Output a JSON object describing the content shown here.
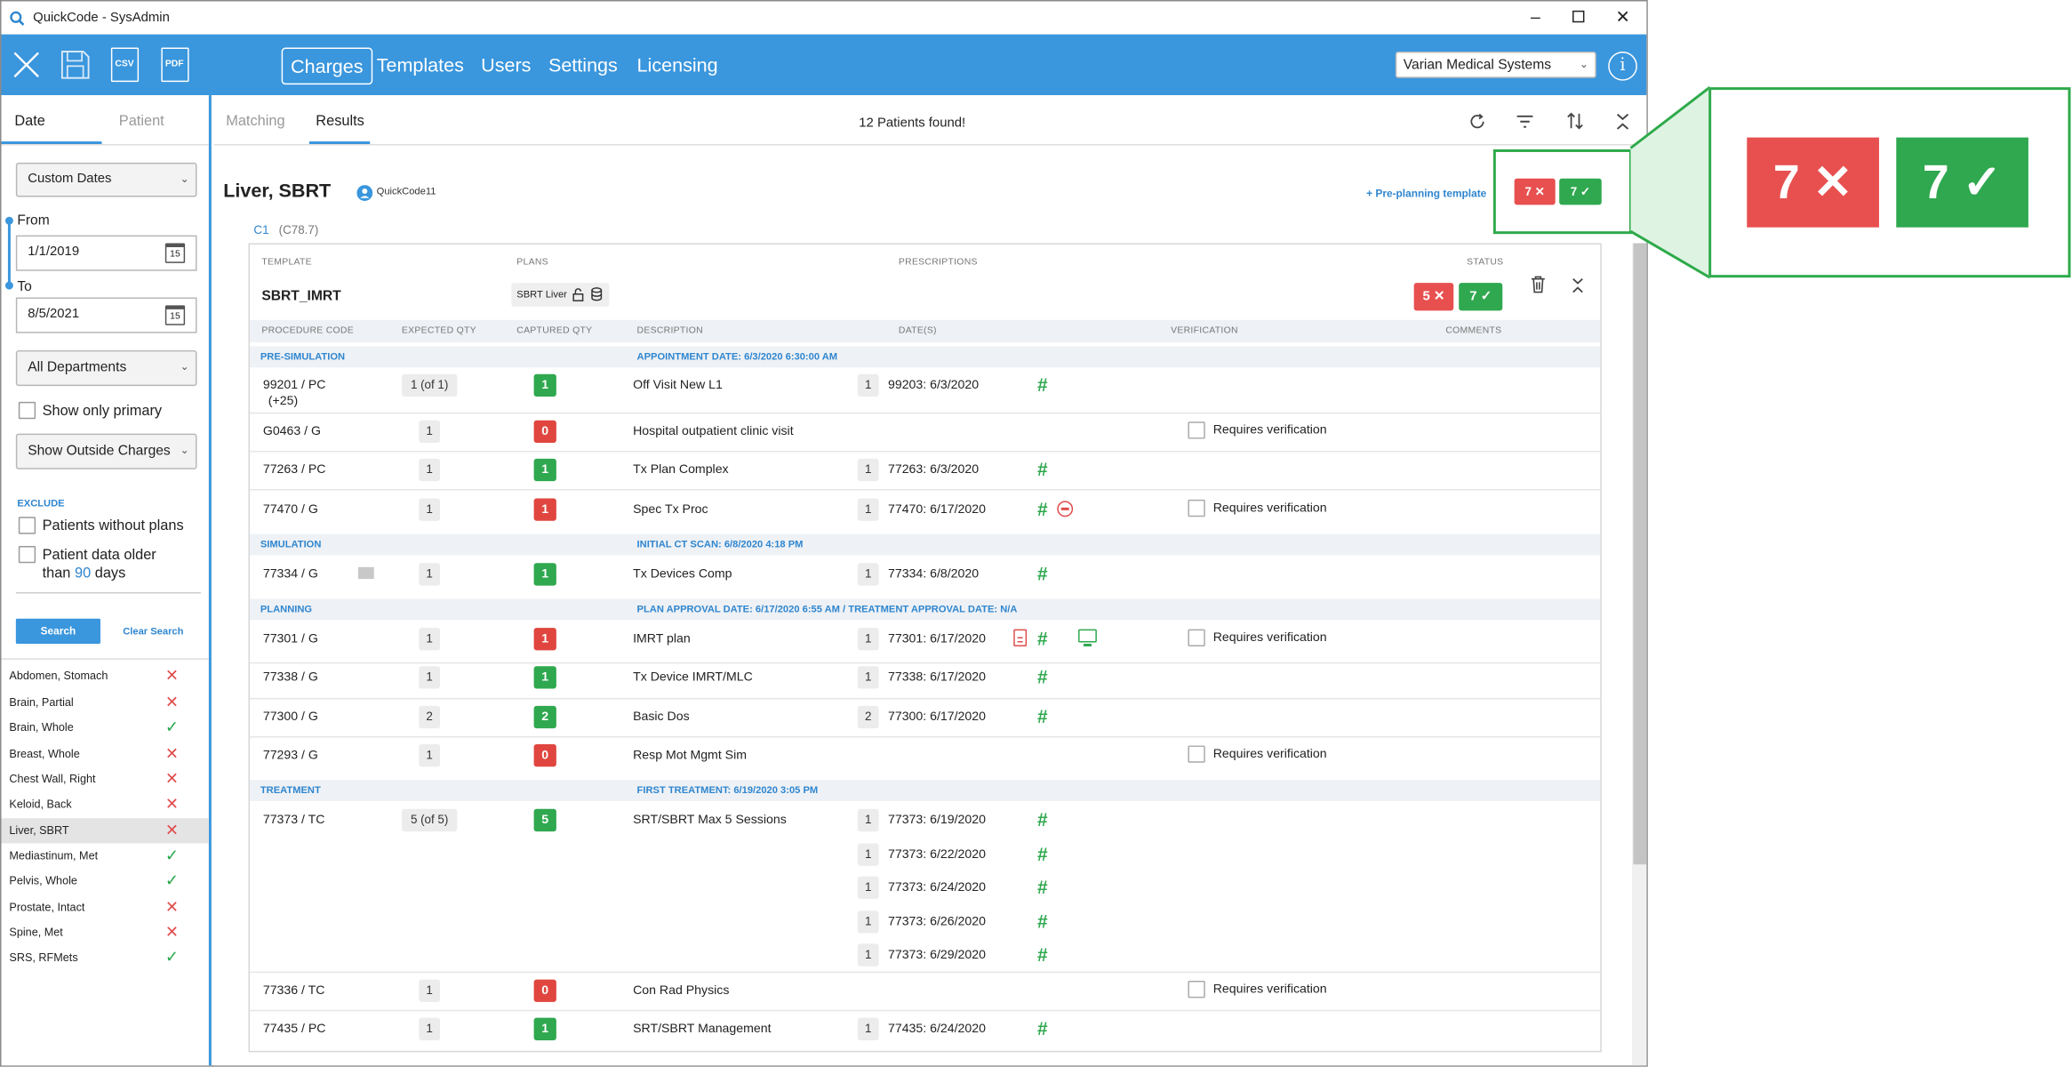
{
  "window": {
    "title": "QuickCode - SysAdmin"
  },
  "toolbar": {
    "nav": [
      "Charges",
      "Templates",
      "Users",
      "Settings",
      "Licensing"
    ],
    "vendor": "Varian Medical Systems",
    "csv_label": "CSV",
    "pdf_label": "PDF",
    "info_label": "i"
  },
  "sidebar": {
    "tabs": [
      "Date",
      "Patient"
    ],
    "range_select": "Custom Dates",
    "from_label": "From",
    "from_value": "1/1/2019",
    "to_label": "To",
    "to_value": "8/5/2021",
    "calendar_day": "15",
    "department_select": "All Departments",
    "show_only_primary": "Show only primary",
    "outside_select": "Show Outside Charges",
    "exclude_label": "EXCLUDE",
    "patients_without_plans": "Patients without plans",
    "older_line1": "Patient data older",
    "older_than": "than",
    "older_days_value": "90",
    "older_days": "days",
    "search_button": "Search",
    "clear_search": "Clear Search",
    "patients": [
      {
        "name": "Abdomen, Stomach",
        "status": "x"
      },
      {
        "name": "Brain, Partial",
        "status": "x"
      },
      {
        "name": "Brain, Whole",
        "status": "check"
      },
      {
        "name": "Breast, Whole",
        "status": "x"
      },
      {
        "name": "Chest Wall, Right",
        "status": "x"
      },
      {
        "name": "Keloid, Back",
        "status": "x"
      },
      {
        "name": "Liver, SBRT",
        "status": "x"
      },
      {
        "name": "Mediastinum, Met",
        "status": "check"
      },
      {
        "name": "Pelvis, Whole",
        "status": "check"
      },
      {
        "name": "Prostate, Intact",
        "status": "x"
      },
      {
        "name": "Spine, Met",
        "status": "x"
      },
      {
        "name": "SRS, RFMets",
        "status": "check"
      }
    ]
  },
  "main": {
    "tabs": [
      "Matching",
      "Results"
    ],
    "found": "12 Patients found!",
    "patient_name": "Liver, SBRT",
    "patient_user": "QuickCode11",
    "preplanning": "+ Pre-planning template",
    "summary_fail": "7 ✕",
    "summary_pass": "7 ✓",
    "course": "C1",
    "diagnosis": "(C78.7)",
    "headers": {
      "template": "TEMPLATE",
      "plans": "PLANS",
      "prescriptions": "PRESCRIPTIONS",
      "status": "STATUS"
    },
    "template_name": "SBRT_IMRT",
    "plan_name": "SBRT Liver",
    "status_fail": "5 ✕",
    "status_pass": "7 ✓",
    "columns": [
      "PROCEDURE CODE",
      "EXPECTED QTY",
      "CAPTURED QTY",
      "DESCRIPTION",
      "DATE(S)",
      "VERIFICATION",
      "COMMENTS"
    ],
    "requires_verification": "Requires verification",
    "sections": {
      "presim": {
        "name": "PRE-SIMULATION",
        "info": "APPOINTMENT DATE: 6/3/2020 6:30:00 AM"
      },
      "sim": {
        "name": "SIMULATION",
        "info": "INITIAL CT SCAN: 6/8/2020 4:18 PM"
      },
      "planning": {
        "name": "PLANNING",
        "info": "PLAN APPROVAL DATE: 6/17/2020 6:55 AM  /  TREATMENT APPROVAL DATE: N/A"
      },
      "treatment": {
        "name": "TREATMENT",
        "info": "FIRST TREATMENT: 6/19/2020 3:05 PM"
      }
    },
    "rows": {
      "r1": {
        "code": "99201 / PC",
        "code2": "(+25)",
        "exp": "1 (of 1)",
        "cap": "1",
        "desc": "Off Visit New L1",
        "dq": "1",
        "date": "99203: 6/3/2020"
      },
      "r2": {
        "code": "G0463 / G",
        "exp": "1",
        "cap": "0",
        "desc": "Hospital outpatient clinic visit"
      },
      "r3": {
        "code": "77263 / PC",
        "exp": "1",
        "cap": "1",
        "desc": "Tx Plan Complex",
        "dq": "1",
        "date": "77263: 6/3/2020"
      },
      "r4": {
        "code": "77470 / G",
        "exp": "1",
        "cap": "1",
        "desc": "Spec Tx Proc",
        "dq": "1",
        "date": "77470: 6/17/2020"
      },
      "r5": {
        "code": "77334 / G",
        "exp": "1",
        "cap": "1",
        "desc": "Tx Devices Comp",
        "dq": "1",
        "date": "77334: 6/8/2020"
      },
      "r6": {
        "code": "77301 / G",
        "exp": "1",
        "cap": "1",
        "desc": "IMRT plan",
        "dq": "1",
        "date": "77301: 6/17/2020"
      },
      "r7": {
        "code": "77338 / G",
        "exp": "1",
        "cap": "1",
        "desc": "Tx Device IMRT/MLC",
        "dq": "1",
        "date": "77338: 6/17/2020"
      },
      "r8": {
        "code": "77300 / G",
        "exp": "2",
        "cap": "2",
        "desc": "Basic Dos",
        "dq": "2",
        "date": "77300: 6/17/2020"
      },
      "r9": {
        "code": "77293 / G",
        "exp": "1",
        "cap": "0",
        "desc": "Resp Mot Mgmt Sim"
      },
      "r10": {
        "code": "77373 / TC",
        "exp": "5 (of 5)",
        "cap": "5",
        "desc": "SRT/SBRT Max 5 Sessions",
        "dq": "1",
        "dates": [
          "77373: 6/19/2020",
          "77373: 6/22/2020",
          "77373: 6/24/2020",
          "77373: 6/26/2020",
          "77373: 6/29/2020"
        ]
      },
      "r11": {
        "code": "77336 / TC",
        "exp": "1",
        "cap": "0",
        "desc": "Con Rad Physics"
      },
      "r12": {
        "code": "77435 / PC",
        "exp": "1",
        "cap": "1",
        "desc": "SRT/SBRT Management",
        "dq": "1",
        "date": "77435: 6/24/2020"
      }
    }
  },
  "callout": {
    "fail": "7 ✕",
    "pass": "7 ✓"
  },
  "colors": {
    "accent": "#3a96dd",
    "fail": "#e85050",
    "pass": "#2fa84f",
    "callout_border": "#2eaa4a"
  }
}
